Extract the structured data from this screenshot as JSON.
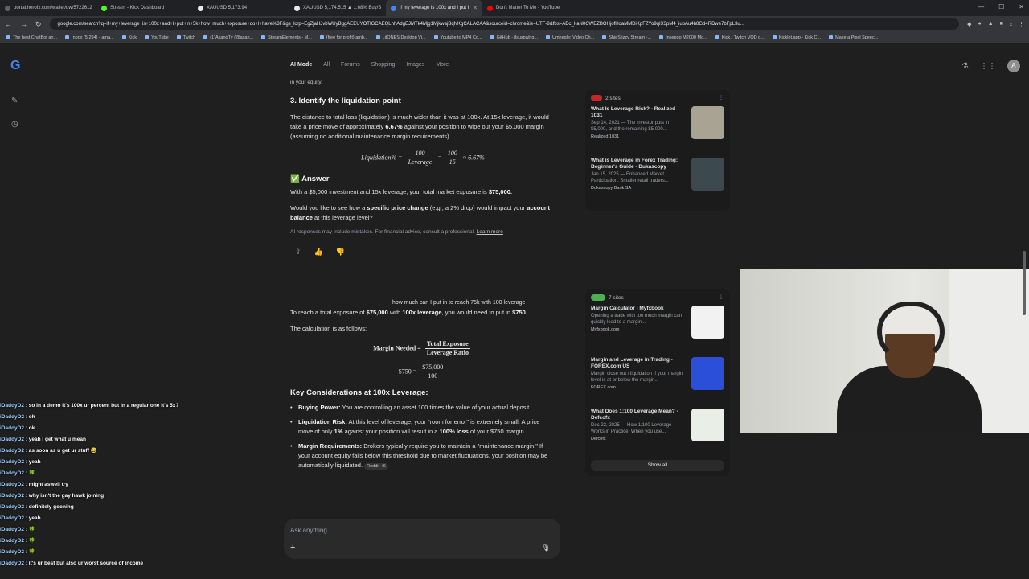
{
  "browser": {
    "tabs": [
      {
        "label": "portal.herofx.com/wallet/dw/5722612",
        "color": "#5f6368"
      },
      {
        "label": "Stream - Kick Dashboard",
        "color": "#53fc18"
      },
      {
        "label": "XAUUSD 5,173.94",
        "color": "#e8eaed"
      },
      {
        "label": "XAUUSD 5,174.515 ▲ 1.68% Buy/S",
        "color": "#e8eaed"
      },
      {
        "label": "if my leverage is 100x and I put i",
        "color": "#4285f4"
      },
      {
        "label": "Don't Matter To Me - YouTube",
        "color": "#ff0000"
      }
    ],
    "url": "google.com/search?q=if+my+leverage+is+100x+and+I+put+in+5k+how+much+exposure+do+I+have%3F&gs_lcrp=EgZjaHJvbWUyBggAEEUYOTIGCAEQLhhAdgEJMTk4Mjg1MjkwajBqNKgCALACAA&sourceid=chrome&ie=UTF-8&fbs=ADc_l-aN0CWEZBOHjofHoaMMDiKpFZYo9qIX3pM4_iubAu4b8Gd4RDwe7bFpL3u...",
    "bookmarks": [
      "The best ChatBot an...",
      "Inbox (5,294) - ama...",
      "Kick",
      "YouTube",
      "Twitch",
      "(1)AsanoTv (@asan...",
      "StreamElements - M...",
      "{free for profit} amb...",
      "LitONES Desktop Vi...",
      "Youtube to MP4 Co...",
      "GitHub - ilsuspa/ng...",
      "Umhegle: Video Ch...",
      "ShieStizzy Stream -...",
      "Inseego M2000 Mo...",
      "Kick / Twitch VOD d...",
      "Kicklet.app - Kick C...",
      "Make a Pixel Speec..."
    ]
  },
  "google": {
    "logo": "G",
    "nav": [
      "AI Mode",
      "All",
      "Forums",
      "Shopping",
      "Images",
      "More"
    ],
    "avatar": "A"
  },
  "answer": {
    "frag_top": "in your equity.",
    "step3_title": "3. Identify the liquidation point",
    "step3_text": "The distance to total loss (liquidation) is much wider than it was at 100x. At 15x leverage, it would take a price move of approximately",
    "step3_bold": "6.67%",
    "step3_text2": "against your position to wipe out your $5,000 margin (assuming no additional maintenance margin requirements).",
    "liq_label": "Liquidation% =",
    "liq_num1": "100",
    "liq_den1": "Leverage",
    "liq_eq": "=",
    "liq_num2": "100",
    "liq_den2": "15",
    "liq_result": "≈ 6.67%",
    "answer_title": "✅ Answer",
    "answer_text": "With a $5,000 investment and 15x leverage, your total market exposure is",
    "answer_bold": "$75,000.",
    "followup_a": "Would you like to see how a",
    "followup_b": "specific price change",
    "followup_c": "(e.g., a 2% drop) would impact your",
    "followup_d": "account balance",
    "followup_e": "at this leverage level?",
    "disclaimer": "AI responses may include mistakes. For financial advice, consult a professional.",
    "learn_more": "Learn more",
    "user_query": "how much can I put in to reach 75k with 100 leverage",
    "reply_a": "To reach a total exposure of",
    "reply_b": "$75,000",
    "reply_c": "with",
    "reply_d": "100x leverage",
    "reply_e": ", you would need to put in",
    "reply_f": "$750.",
    "calc_intro": "The calculation is as follows:",
    "margin_label": "Margin Needed =",
    "margin_num": "Total Exposure",
    "margin_den": "Leverage Ratio",
    "calc2_label": "$750 =",
    "calc2_num": "$75,000",
    "calc2_den": "100",
    "key_title": "Key Considerations at 100x Leverage:",
    "bp_label": "Buying Power:",
    "bp_text": "You are controlling an asset 100 times the value of your actual deposit.",
    "lr_label": "Liquidation Risk:",
    "lr_text_a": "At this level of leverage, your \"room for error\" is extremely small. A price move of only",
    "lr_bold1": "1%",
    "lr_text_b": "against your position will result in a",
    "lr_bold2": "100% loss",
    "lr_text_c": "of your $750 margin.",
    "mr_label": "Margin Requirements:",
    "mr_text": "Brokers typically require you to maintain a \"maintenance margin.\" If your account equity falls below this threshold due to market fluctuations, your position may be automatically liquidated.",
    "mr_chip": "Reddit +6"
  },
  "sources1": {
    "count": "2 sites",
    "items": [
      {
        "title": "What Is Leverage Risk? - Realized 1031",
        "snippet": "Sep 14, 2021 — The investor puts in $5,000, and the remaining $5,000...",
        "site": "Realized 1031",
        "thumb": "#a9a393"
      },
      {
        "title": "What is Leverage in Forex Trading: Beginner's Guide - Dukascopy",
        "snippet": "Jan 15, 2025 — Enhanced Market Participation. Smaller retail traders...",
        "site": "Dukascopy Bank SA",
        "thumb": "#3c4a4f"
      }
    ]
  },
  "sources2": {
    "count": "7 sites",
    "items": [
      {
        "title": "Margin Calculator | Myfxbook",
        "snippet": "Opening a trade with too much margin can quickly lead to a margin...",
        "site": "Myfxbook.com",
        "thumb": "#f2f2f2"
      },
      {
        "title": "Margin and Leverage in Trading - FOREX.com US",
        "snippet": "Margin close out / liquidation If your margin level is at or below the margin...",
        "site": "FOREX.com",
        "thumb": "#2b4fd8"
      },
      {
        "title": "What Does 1:100 Leverage Mean? - Defcofx",
        "snippet": "Dec 22, 2025 — How 1:100 Leverage Works in Practice. When you use...",
        "site": "Defcofx",
        "thumb": "#e9efe6"
      }
    ],
    "show_all": "Show all"
  },
  "chat": [
    {
      "user": "iDaddyD2 :",
      "msg": "so in a demo it's 100x ur percent but in a regular one it's 5x?"
    },
    {
      "user": "iDaddyD2 :",
      "msg": "oh"
    },
    {
      "user": "iDaddyD2 :",
      "msg": "ok"
    },
    {
      "user": "iDaddyD2 :",
      "msg": "yeah I get what u mean"
    },
    {
      "user": "iDaddyD2 :",
      "msg": "as soon as u get ur stuff 😄"
    },
    {
      "user": "iDaddyD2 :",
      "msg": "yeah"
    },
    {
      "user": "iDaddyD2 :",
      "msg": "🍀"
    },
    {
      "user": "iDaddyD2 :",
      "msg": "might aswell try"
    },
    {
      "user": "iDaddyD2 :",
      "msg": "why isn't the gay hawk joining"
    },
    {
      "user": "iDaddyD2 :",
      "msg": "definitely gooning"
    },
    {
      "user": "iDaddyD2 :",
      "msg": "yeah"
    },
    {
      "user": "iDaddyD2 :",
      "msg": "🍀"
    },
    {
      "user": "iDaddyD2 :",
      "msg": "🍀"
    },
    {
      "user": "iDaddyD2 :",
      "msg": "🍀"
    },
    {
      "user": "iDaddyD2 :",
      "msg": "it's ur best but also ur worst source of income"
    }
  ],
  "ask": {
    "placeholder": "Ask anything"
  },
  "icons": {
    "plus": "+",
    "mic": "🎙",
    "share": "⇪",
    "like": "👍",
    "dislike": "👎"
  }
}
